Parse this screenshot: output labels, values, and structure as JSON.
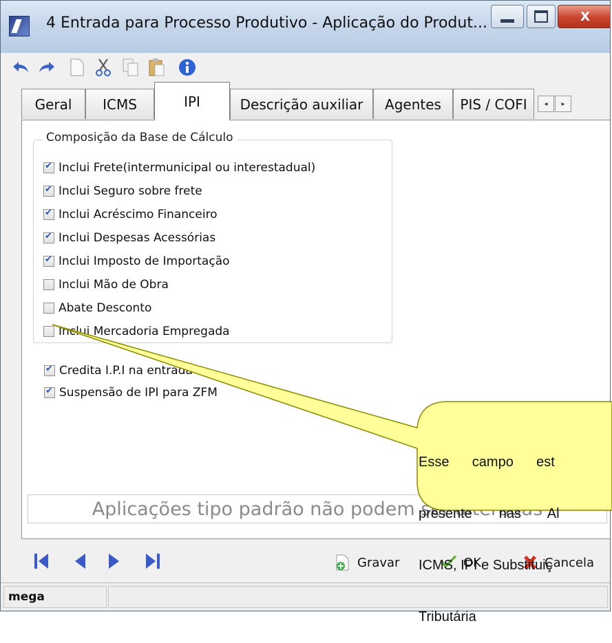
{
  "window": {
    "title": "4 Entrada para Processo Produtivo -  Aplicação do Produt...",
    "close_glyph": "X"
  },
  "toolbar": {
    "icons": [
      "undo-icon",
      "redo-icon",
      "new-document-icon",
      "cut-icon",
      "copy-icon",
      "paste-icon",
      "info-icon"
    ]
  },
  "tabs": [
    {
      "label": "Geral",
      "active": false
    },
    {
      "label": "ICMS",
      "active": false
    },
    {
      "label": "IPI",
      "active": true
    },
    {
      "label": "Descrição auxiliar",
      "active": false
    },
    {
      "label": "Agentes",
      "active": false
    },
    {
      "label": "PIS / COFI",
      "active": false
    }
  ],
  "tab_scroll": {
    "left": "◂",
    "right": "▸"
  },
  "group": {
    "title": "Composição da Base de Cálculo",
    "items": [
      {
        "label": "Inclui Frete(intermunicipal ou interestadual)",
        "checked": true
      },
      {
        "label": "Inclui Seguro sobre frete",
        "checked": true
      },
      {
        "label": "Inclui Acréscimo Financeiro",
        "checked": true
      },
      {
        "label": "Inclui Despesas Acessórias",
        "checked": true
      },
      {
        "label": "Inclui Imposto de Importação",
        "checked": true
      },
      {
        "label": "Inclui Mão de Obra",
        "checked": false
      },
      {
        "label": "Abate Desconto",
        "checked": false
      },
      {
        "label": "Inclui Mercadoria Empregada",
        "checked": false
      }
    ]
  },
  "options": [
    {
      "label": "Credita I.P.I na entrada",
      "checked": true
    },
    {
      "label": "Suspensão de IPI para ZFM",
      "checked": true
    }
  ],
  "notice": "Aplicações tipo padrão não podem ser alteradas",
  "navigation": {
    "icons": [
      "first-record-icon",
      "previous-record-icon",
      "next-record-icon",
      "last-record-icon"
    ]
  },
  "actions": {
    "save": "Gravar",
    "ok": "OK",
    "cancel": "Cancela"
  },
  "status": {
    "user": "mega"
  },
  "callout": {
    "lines": [
      "Esse      campo      est",
      "presente       nas       Al",
      "ICMS, IPI e Substituiç",
      "Tributária"
    ],
    "fill": "#ffff99"
  },
  "colors": {
    "nav": "#3a5ac8",
    "check": "#2c55b5",
    "callout_border": "#8a8a00"
  }
}
